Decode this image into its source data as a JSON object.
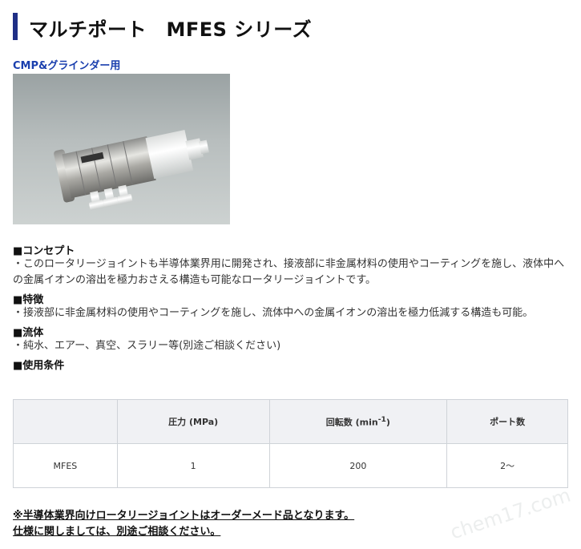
{
  "header": {
    "title": "マルチポート　MFES シリーズ"
  },
  "product": {
    "subtitle": "CMP&グラインダー用",
    "image_alt": "MFES ロータリージョイント"
  },
  "sections": [
    {
      "heading": "■コンセプト",
      "text": "・このロータリージョイントも半導体業界用に開発され、接液部に非金属材料の使用やコーティングを施し、液体中への金属イオンの溶出を極力おさえる構造も可能なロータリージョイントです。"
    },
    {
      "heading": "■特徴",
      "text": "・接液部に非金属材料の使用やコーティングを施し、流体中への金属イオンの溶出を極力低減する構造も可能。"
    },
    {
      "heading": "■流体",
      "text": "・純水、エアー、真空、スラリー等(別途ご相談ください)"
    },
    {
      "heading": "■使用条件",
      "text": ""
    }
  ],
  "spec_table": {
    "headers": [
      "",
      "圧力 (MPa)",
      "回転数 (min",
      "ポート数"
    ],
    "rpm_unit_sup": "-1",
    "rpm_close": ")",
    "rows": [
      [
        "MFES",
        "1",
        "200",
        "2〜"
      ]
    ]
  },
  "notes": [
    "※半導体業界向けロータリージョイントはオーダーメード品となります。",
    "仕様に関しましては、別途ご相談ください。"
  ],
  "watermark": "chem17.com"
}
